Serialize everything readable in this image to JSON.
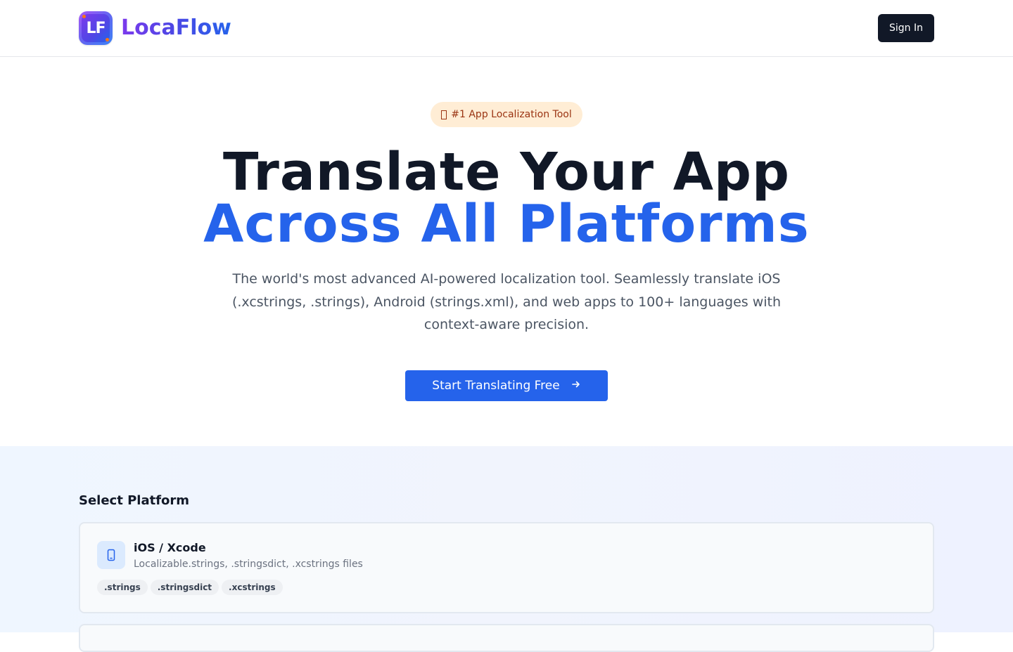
{
  "header": {
    "logo_text": "LF",
    "brand_name": "LocaFlow",
    "signin_label": "Sign In"
  },
  "hero": {
    "badge": "#1 App Localization Tool",
    "title_line1": "Translate Your App",
    "title_line2": "Across All Platforms",
    "description": "The world's most advanced AI-powered localization tool. Seamlessly translate iOS (.xcstrings, .strings), Android (strings.xml), and web apps to 100+ languages with context-aware precision.",
    "cta_label": "Start Translating Free"
  },
  "platforms": {
    "section_title": "Select Platform",
    "items": [
      {
        "name": "iOS / Xcode",
        "description": "Localizable.strings, .stringsdict, .xcstrings files",
        "icon": "smartphone-icon",
        "formats": [
          ".strings",
          ".stringsdict",
          ".xcstrings"
        ]
      }
    ]
  },
  "colors": {
    "primary": "#2563eb",
    "dark": "#111827",
    "badge_bg": "#ffedd5",
    "badge_text": "#9a3412"
  }
}
